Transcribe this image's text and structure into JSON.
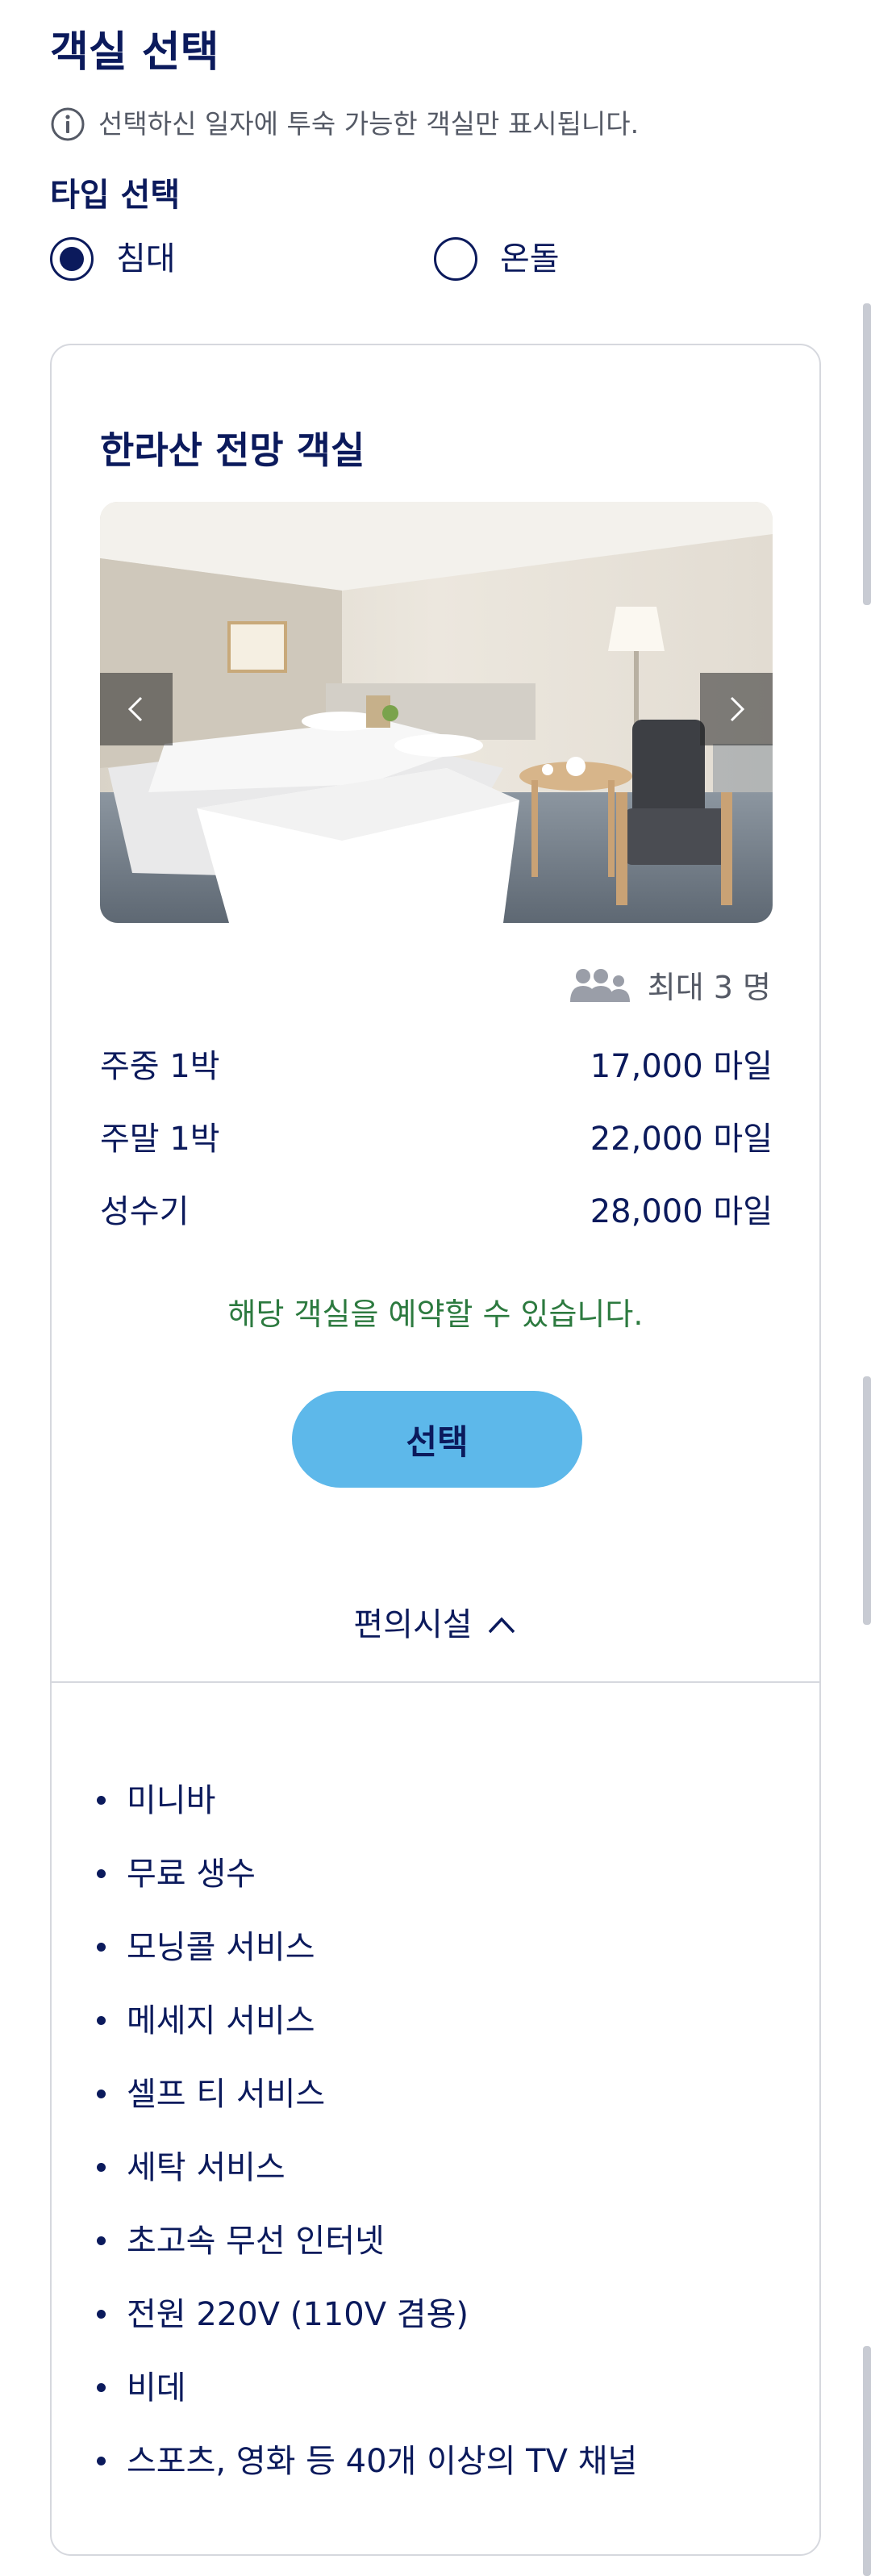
{
  "page": {
    "title": "객실 선택",
    "notice": "선택하신 일자에 투숙 가능한 객실만 표시됩니다."
  },
  "type_select": {
    "label": "타입 선택",
    "options": [
      {
        "label": "침대",
        "selected": true
      },
      {
        "label": "온돌",
        "selected": false
      }
    ]
  },
  "room": {
    "title": "한라산 전망 객실",
    "capacity": "최대 3 명",
    "prices": [
      {
        "label": "주중 1박",
        "value": "17,000 마일"
      },
      {
        "label": "주말 1박",
        "value": "22,000 마일"
      },
      {
        "label": "성수기",
        "value": "28,000 마일"
      }
    ],
    "availability": "해당 객실을 예약할 수 있습니다.",
    "select_label": "선택",
    "amenities_label": "편의시설",
    "amenities": [
      "미니바",
      "무료 생수",
      "모닝콜 서비스",
      "메세지 서비스",
      "셀프 티 서비스",
      "세탁 서비스",
      "초고속 무선 인터넷",
      "전원 220V (110V 겸용)",
      "비데",
      "스포츠, 영화 등 40개 이상의 TV 채널"
    ]
  },
  "icons": {
    "info": "info-icon",
    "capacity": "people-icon",
    "prev": "chevron-left-icon",
    "next": "chevron-right-icon",
    "toggle": "chevron-up-icon"
  },
  "colors": {
    "primary_text": "#0b1a5c",
    "accent_button": "#5db8ea",
    "available_text": "#2c7a3f",
    "muted_text": "#555a66"
  }
}
